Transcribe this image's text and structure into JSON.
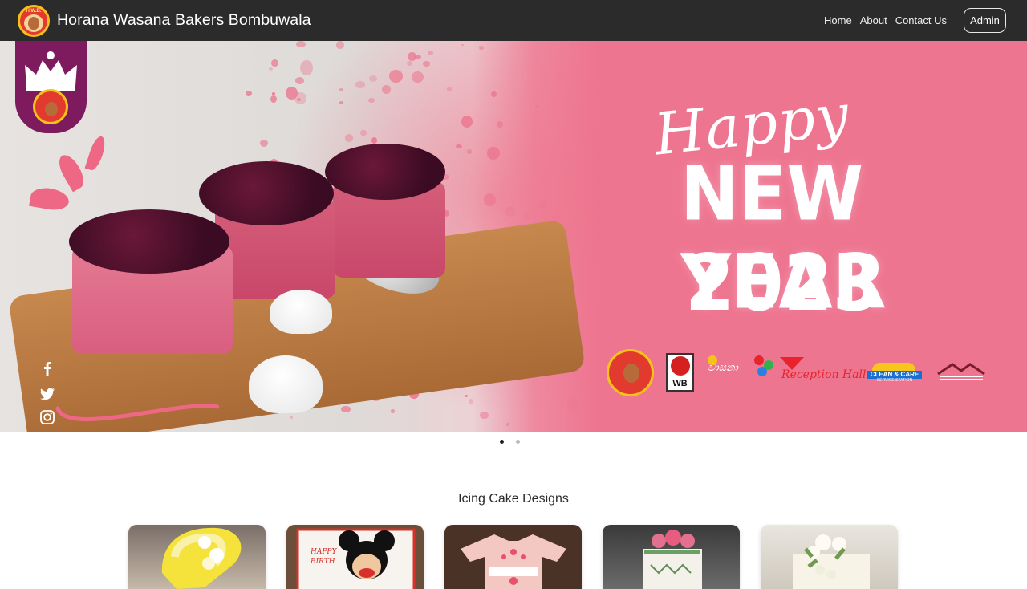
{
  "navbar": {
    "brand_name": "Horana Wasana Bakers Bombuwala",
    "logo_text": "H.W.B.",
    "links": [
      "Home",
      "About",
      "Contact Us"
    ],
    "admin_label": "Admin"
  },
  "hero": {
    "happy_text": "Happy",
    "new_year_text": "NEW YEAR",
    "year_text": "2023",
    "sponsors": {
      "wb_text": "WB",
      "vasa_text": "වාසනා",
      "reception_text": "Reception Hall",
      "clean_title": "CLEAN & CARE",
      "clean_sub": "SERVICE STATION"
    },
    "social_icons": [
      "facebook-icon",
      "twitter-icon",
      "instagram-icon"
    ]
  },
  "carousel": {
    "slide_count": 2,
    "active_index": 0
  },
  "section": {
    "title": "Icing Cake Designs"
  },
  "colors": {
    "navbar_bg": "#2b2b2b",
    "hero_pink": "#ee7590",
    "badge_purple": "#7e1b5e",
    "accent_red": "#e23a2e",
    "accent_gold": "#f6c21a"
  }
}
